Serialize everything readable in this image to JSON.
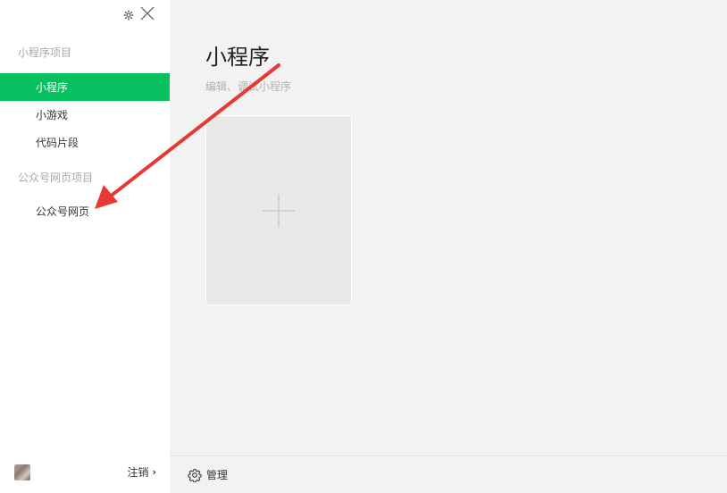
{
  "sidebar": {
    "sections": [
      {
        "title": "小程序项目",
        "items": [
          {
            "label": "小程序",
            "active": true
          },
          {
            "label": "小游戏",
            "active": false
          },
          {
            "label": "代码片段",
            "active": false
          }
        ]
      },
      {
        "title": "公众号网页项目",
        "items": [
          {
            "label": "公众号网页",
            "active": false
          }
        ]
      }
    ],
    "footer": {
      "logout_label": "注销",
      "logout_chevron": "›"
    }
  },
  "main": {
    "title": "小程序",
    "subtitle": "编辑、调试小程序",
    "footer": {
      "manage_label": "管理"
    }
  },
  "colors": {
    "accent": "#07c160",
    "annotation_arrow": "#e53935"
  },
  "icons": [
    "gear-icon",
    "close-icon",
    "plus-icon",
    "chevron-right-icon",
    "settings-icon"
  ]
}
